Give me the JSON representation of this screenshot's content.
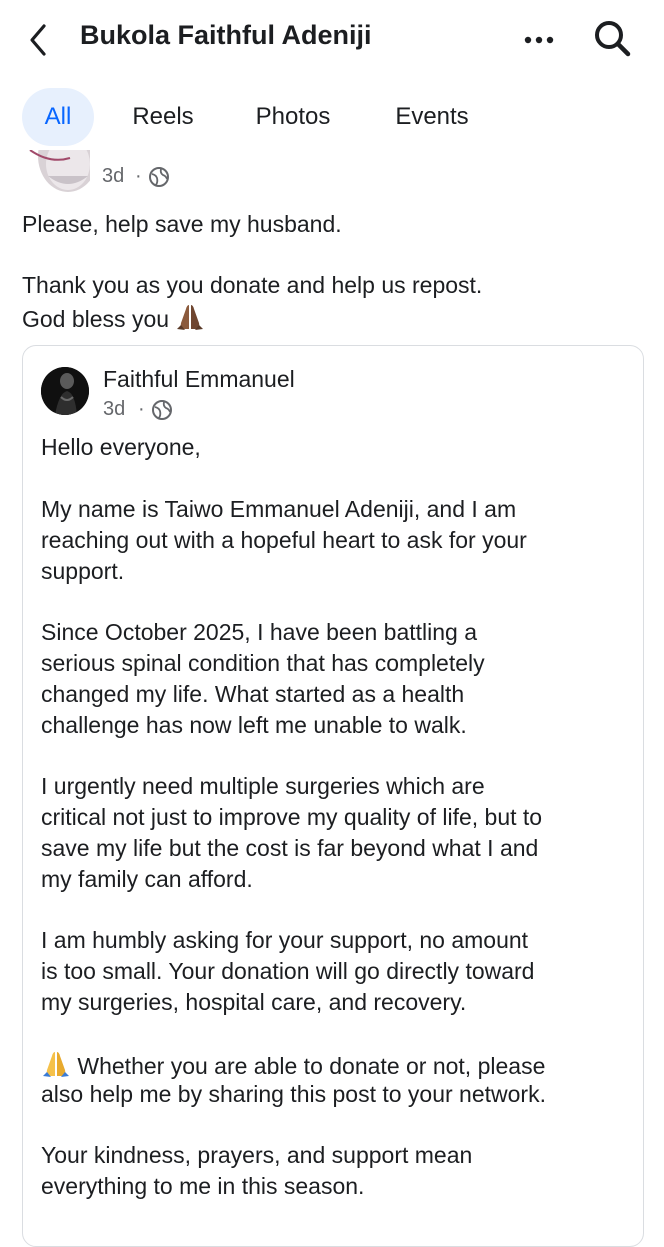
{
  "header": {
    "title": "Bukola Faithful Adeniji",
    "back_icon": "chevron-left-icon",
    "more_icon": "more-horizontal-icon",
    "search_icon": "search-icon"
  },
  "tabs": [
    {
      "label": "All",
      "active": true
    },
    {
      "label": "Reels",
      "active": false
    },
    {
      "label": "Photos",
      "active": false
    },
    {
      "label": "Events",
      "active": false
    }
  ],
  "post": {
    "time": "3d",
    "separator": "·",
    "privacy_icon": "globe-icon",
    "lines": [
      "Please, help save my husband.",
      "Thank you as you donate and help us repost.",
      "God bless you"
    ],
    "emoji": "folded-hands-emoji"
  },
  "shared_post": {
    "author": "Faithful Emmanuel",
    "time": "3d",
    "separator": "·",
    "privacy_icon": "globe-icon",
    "lines": [
      "Hello everyone,",
      "My name is Taiwo Emmanuel Adeniji, and I am",
      "reaching out with a hopeful heart to ask for your",
      "support.",
      "Since October 2025, I have been battling a",
      "serious spinal condition that has completely",
      "changed my life. What started as a health",
      "challenge has now left me unable to walk.",
      "I urgently need multiple surgeries which are",
      "critical not just to improve my quality of life, but to",
      "save my life but the cost is far beyond what I and",
      "my family can afford.",
      "I am humbly asking for your support, no amount",
      "is too small. Your donation will go directly toward",
      "my surgeries, hospital care, and recovery.",
      "Whether you are able to donate or not, please",
      "also help me by sharing this post to your network.",
      "Your kindness, prayers, and support mean",
      "everything to me in this season."
    ]
  },
  "colors": {
    "accent": "#0866ff",
    "tab_active_bg": "#e7f0fd",
    "text_primary": "#1c1e21",
    "text_secondary": "#65676b",
    "border": "#dadde1"
  }
}
